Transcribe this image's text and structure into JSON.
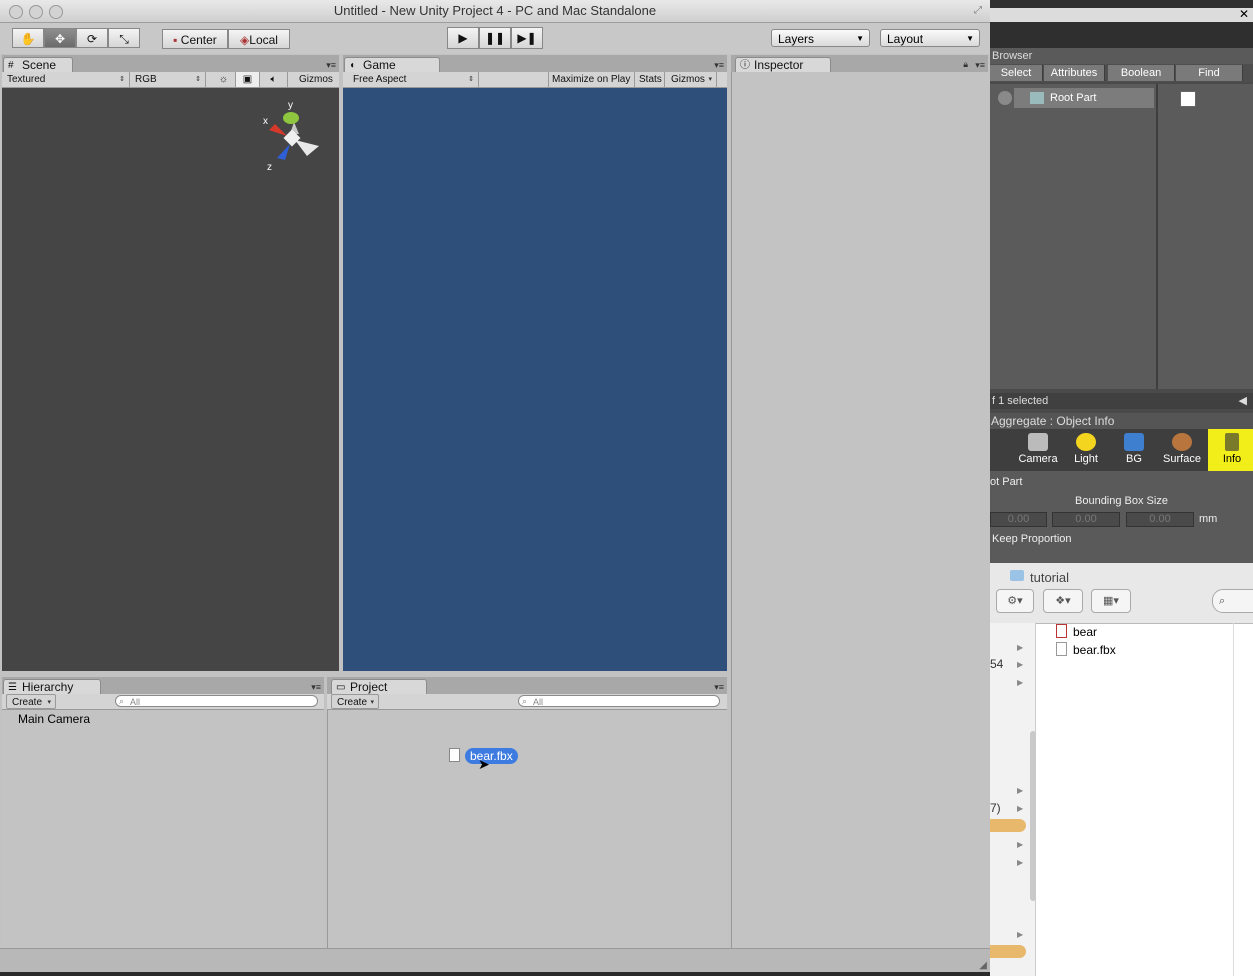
{
  "window": {
    "title": "Untitled - New Unity Project 4 - PC and Mac Standalone"
  },
  "toolbar": {
    "tools": [
      "hand-tool",
      "move-tool",
      "rotate-tool",
      "scale-tool"
    ],
    "pivot": "Center",
    "space": "Local",
    "layers": "Layers",
    "layout": "Layout"
  },
  "scene": {
    "tab": "Scene",
    "render_mode": "Textured",
    "color_mode": "RGB",
    "gizmos": "Gizmos",
    "axes": {
      "y": "y",
      "x": "x",
      "z": "z"
    }
  },
  "game": {
    "tab": "Game",
    "aspect": "Free Aspect",
    "maximize": "Maximize on Play",
    "stats": "Stats",
    "gizmos": "Gizmos",
    "background": "#2f4f7b"
  },
  "inspector": {
    "tab": "Inspector"
  },
  "hierarchy": {
    "tab": "Hierarchy",
    "create": "Create",
    "search_placeholder": "All",
    "items": [
      "Main Camera"
    ]
  },
  "project": {
    "tab": "Project",
    "create": "Create",
    "search_placeholder": "All",
    "asset": "bear.fbx"
  },
  "bgapp": {
    "browser_title": "Browser",
    "tabs": [
      "Select",
      "Attributes",
      "Boolean",
      "Find"
    ],
    "root_part": "Root Part",
    "selected": "f 1 selected",
    "aggregate": "Aggregate : Object Info",
    "tools": [
      "Camera",
      "Light",
      "BG",
      "Surface",
      "Info"
    ],
    "root_label": "ot Part",
    "bbox_label": "Bounding Box Size",
    "bbox_values": [
      "0.00",
      "0.00",
      "0.00"
    ],
    "unit": "mm",
    "keep": "Keep Proportion",
    "folder": "tutorial",
    "files": [
      "bear",
      "bear.fbx"
    ],
    "side_nums": [
      "54",
      "7)"
    ]
  }
}
